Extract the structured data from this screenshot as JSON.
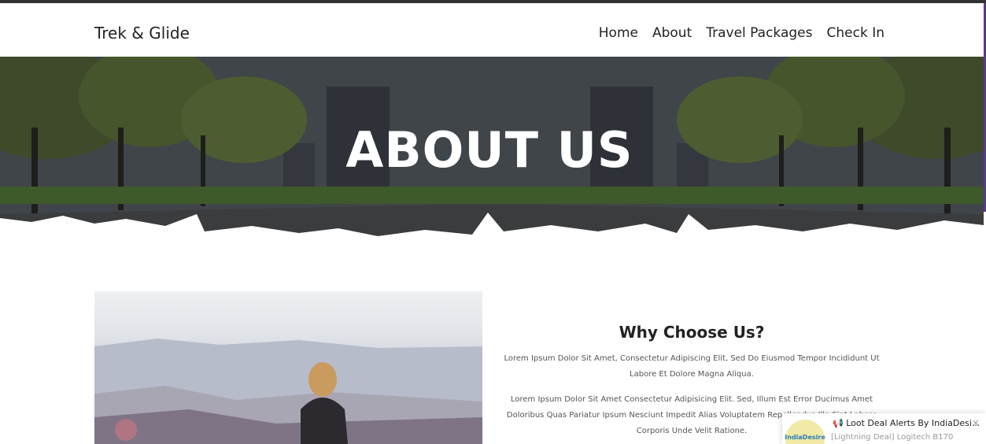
{
  "brand": "Trek & Glide",
  "nav": {
    "items": [
      "Home",
      "About",
      "Travel Packages",
      "Check In"
    ]
  },
  "hero": {
    "title": "ABOUT US"
  },
  "why": {
    "title": "Why Choose Us?",
    "p1": "Lorem Ipsum Dolor Sit Amet, Consectetur Adipiscing Elit, Sed Do Eiusmod Tempor Incididunt Ut Labore Et Dolore Magna Aliqua.",
    "p2": "Lorem Ipsum Dolor Sit Amet Consectetur Adipisicing Elit. Sed, Illum Est Error Ducimus Amet Doloribus Quas Pariatur Ipsum Nesciunt Impedit Alias Voluptatem Repellendus Illo Sint Labore Corporis Unde Velit Ratione."
  },
  "toast": {
    "logo_text": "IndiaDesire",
    "title": "📢 Loot Deal Alerts By IndiaDesi...",
    "subtitle": "[Lightning Deal] Logitech B170",
    "close": "×"
  }
}
